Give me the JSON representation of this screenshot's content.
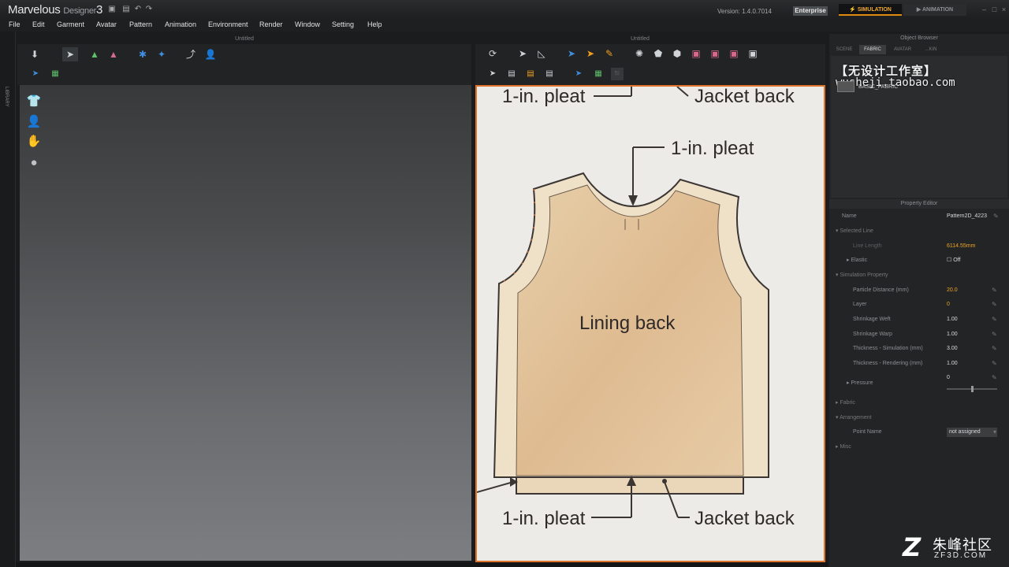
{
  "titlebar": {
    "app_name": "Marvelous",
    "app_sub": "Designer",
    "app_ver": "3",
    "version_text": "Version:  1.4.0.7014",
    "edition": "Enterprise",
    "modes": [
      "SIMULATION",
      "ANIMATION"
    ]
  },
  "menu": [
    "File",
    "Edit",
    "Garment",
    "Avatar",
    "Pattern",
    "Animation",
    "Environment",
    "Render",
    "Window",
    "Setting",
    "Help"
  ],
  "left_strip_label": "LIBRARY",
  "pane_3d": {
    "title": "Untitled"
  },
  "pane_2d": {
    "title": "Untitled"
  },
  "illustration": {
    "labels": {
      "top_left": "1-in. pleat",
      "top_right": "Jacket back",
      "neck": "1-in. pleat",
      "center": "Lining back",
      "bottom_left": "1-in. pleat",
      "bottom_right": "Jacket back"
    },
    "fill_color": "#e3c5a0",
    "stroke_color": "#4a4542"
  },
  "object_browser": {
    "title": "Object Browser",
    "tabs": [
      "SCENE",
      "FABRIC",
      "AVATAR",
      "...KIN"
    ],
    "active_tab": "FABRIC",
    "item_name": "BASIC_FABRIC",
    "watermark_line1": "【无设计工作室】",
    "watermark_line2": "wusheji.taobao.com"
  },
  "property_editor": {
    "title": "Property Editor",
    "name_label": "Name",
    "name_value": "Pattern2D_4223",
    "selected_line": "Selected Line",
    "line_length_label": "Line Length",
    "line_length_value": "6114.55mm",
    "elastic_label": "Elastic",
    "elastic_value": "Off",
    "sim_property": "Simulation Property",
    "particle_label": "Particle Distance (mm)",
    "particle_value": "20.0",
    "layer_label": "Layer",
    "layer_value": "0",
    "shrink_weft_label": "Shrinkage Weft",
    "shrink_weft_value": "1.00",
    "shrink_warp_label": "Shrinkage Warp",
    "shrink_warp_value": "1.00",
    "thick_sim_label": "Thickness - Simulation (mm)",
    "thick_sim_value": "3.00",
    "thick_render_label": "Thickness - Rendering (mm)",
    "thick_render_value": "1.00",
    "pressure_label": "Pressure",
    "pressure_value": "0",
    "fabric_label": "Fabric",
    "arrangement_label": "Arrangement",
    "point_name_label": "Point Name",
    "point_name_value": "not assigned",
    "misc_label": "Misc"
  },
  "corner_logo": {
    "cn": "朱峰社区",
    "domain": "ZF3D.COM"
  }
}
